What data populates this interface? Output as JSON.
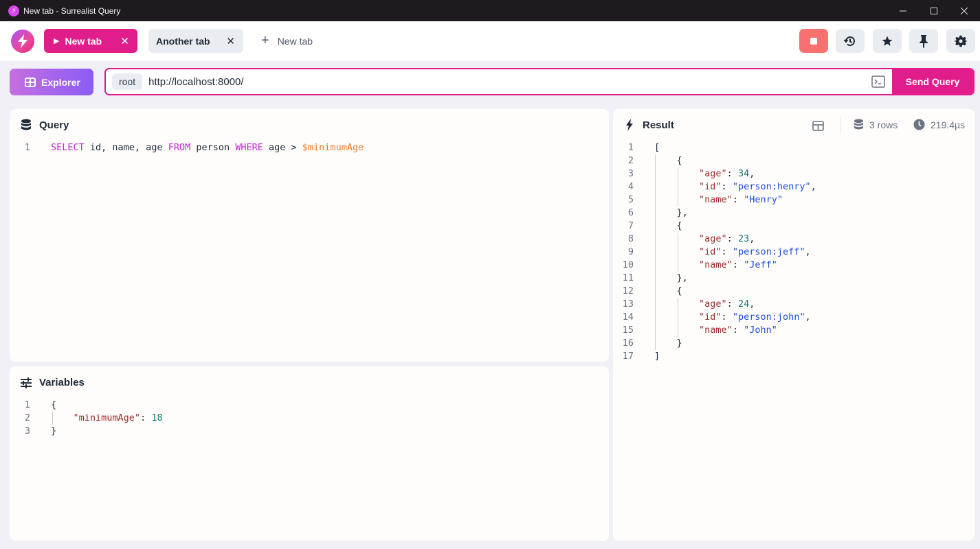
{
  "window": {
    "title": "New tab - Surrealist Query"
  },
  "tabs": [
    {
      "label": "New tab",
      "active": true
    },
    {
      "label": "Another tab",
      "active": false
    }
  ],
  "new_tab_label": "New tab",
  "toolbar_icons": [
    "stop-icon",
    "history-icon",
    "star-icon",
    "pin-icon",
    "settings-icon"
  ],
  "explorer": {
    "label": "Explorer"
  },
  "connection": {
    "namespace": "root",
    "url": "http://localhost:8000/",
    "send_label": "Send Query"
  },
  "query_panel": {
    "title": "Query",
    "lines": [
      "1"
    ]
  },
  "variables_panel": {
    "title": "Variables",
    "lines": [
      "1",
      "2",
      "3"
    ]
  },
  "result_panel": {
    "title": "Result",
    "rows": "3 rows",
    "time": "219.4µs",
    "records": [
      {
        "age": "34",
        "id": "\"person:henry\"",
        "name": "\"Henry\""
      },
      {
        "age": "23",
        "id": "\"person:jeff\"",
        "name": "\"Jeff\""
      },
      {
        "age": "24",
        "id": "\"person:john\"",
        "name": "\"John\""
      }
    ]
  },
  "colors": {
    "accent": "#e11d8b",
    "explorer_gradient_start": "#c56fe0",
    "explorer_gradient_end": "#8b5cf6",
    "stop": "#f87171"
  }
}
